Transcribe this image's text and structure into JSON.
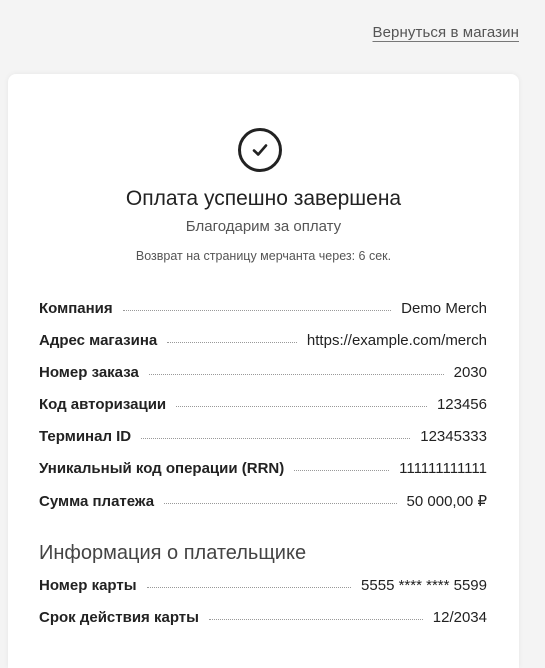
{
  "header": {
    "back_link": "Вернуться в магазин"
  },
  "status": {
    "icon": "check-icon",
    "title": "Оплата успешно завершена",
    "subtitle": "Благодарим за оплату",
    "redirect_text": "Возврат на страницу мерчанта через: 6 сек."
  },
  "details": [
    {
      "label": "Компания",
      "value": "Demo Merch"
    },
    {
      "label": "Адрес магазина",
      "value": "https://example.com/merch"
    },
    {
      "label": "Номер заказа",
      "value": "2030"
    },
    {
      "label": "Код авторизации",
      "value": "123456"
    },
    {
      "label": "Терминал ID",
      "value": "12345333"
    },
    {
      "label": "Уникальный код операции (RRN)",
      "value": "111111111111"
    },
    {
      "label": "Сумма платежа",
      "value": "50 000,00 ₽"
    }
  ],
  "payer": {
    "title": "Информация о плательщике",
    "rows": [
      {
        "label": "Номер карты",
        "value": "5555 **** **** 5599"
      },
      {
        "label": "Срок действия карты",
        "value": "12/2034"
      }
    ]
  }
}
